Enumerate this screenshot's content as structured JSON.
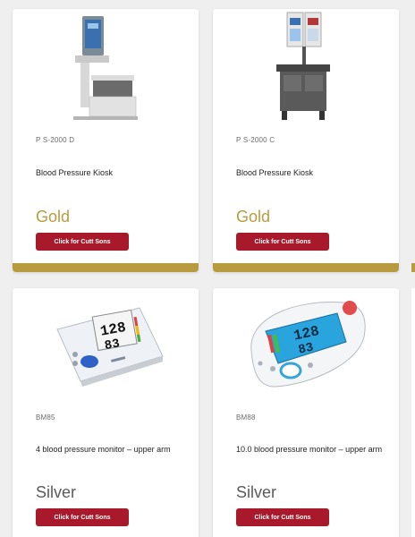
{
  "colors": {
    "gold": "#b89b3f",
    "silver": "#5b5b5b",
    "button": "#a81a2b"
  },
  "products": [
    {
      "code": "P S-2000 D",
      "name": "Blood Pressure Kiosk",
      "tier": "Gold",
      "button_label": "Click for Cutt Sons",
      "image": "kiosk-d-image"
    },
    {
      "code": "P S-2000 C",
      "name": "Blood Pressure Kiosk",
      "tier": "Gold",
      "button_label": "Click for Cutt Sons",
      "image": "kiosk-c-image"
    },
    {
      "code": "BM85",
      "name": "4 blood pressure monitor – upper arm",
      "tier": "Silver",
      "button_label": "Click for Cutt Sons",
      "image": "monitor-bm85-image"
    },
    {
      "code": "BM88",
      "name": "10.0 blood pressure monitor – upper arm",
      "tier": "Silver",
      "button_label": "Click for Cutt Sons",
      "image": "monitor-bm88-image"
    }
  ]
}
